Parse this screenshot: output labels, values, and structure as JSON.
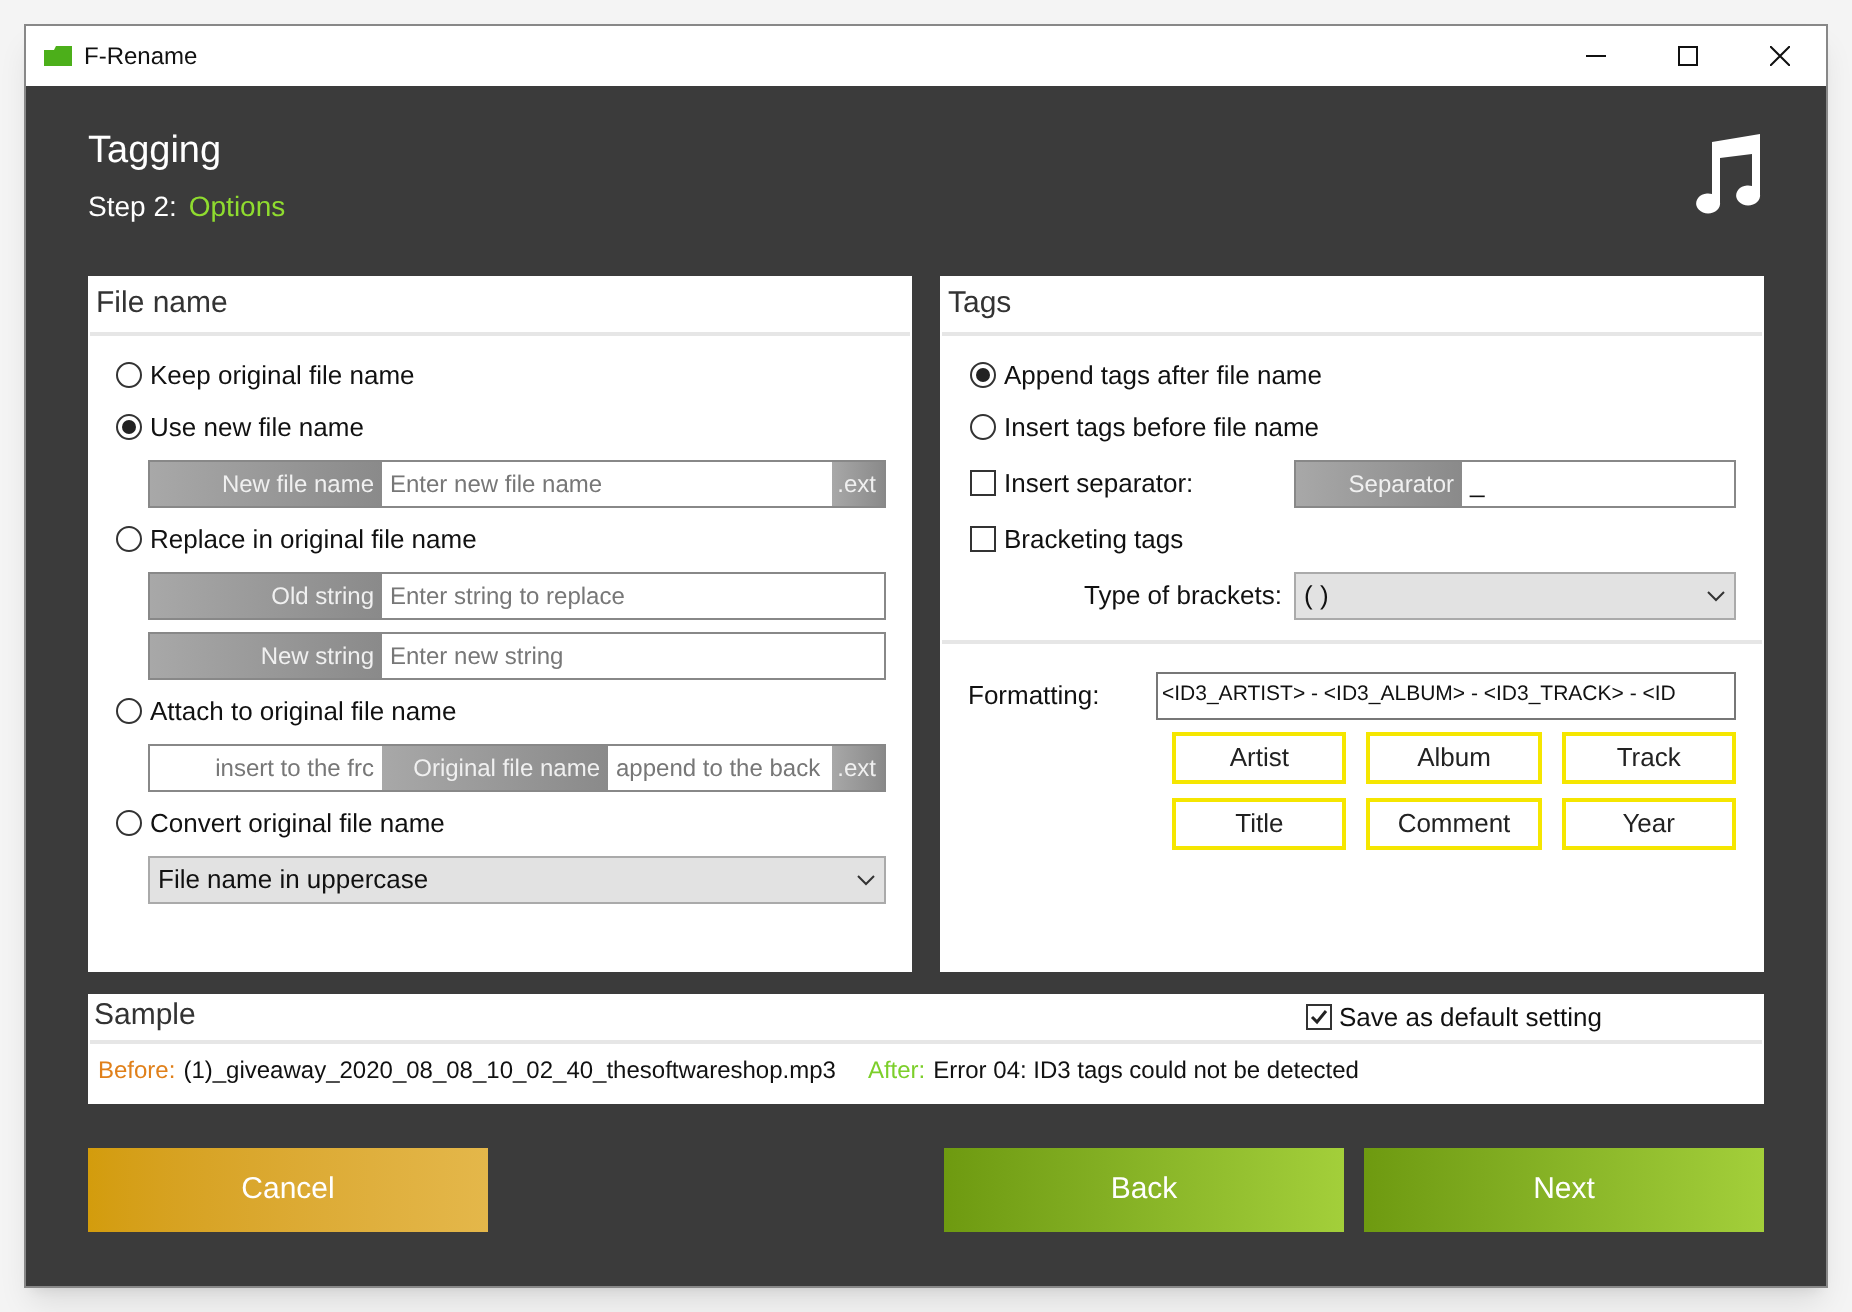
{
  "window": {
    "title": "F-Rename"
  },
  "header": {
    "title": "Tagging",
    "step_label": "Step 2:",
    "step_value": "Options"
  },
  "file_name": {
    "title": "File name",
    "options": [
      {
        "label": "Keep original file name",
        "selected": false
      },
      {
        "label": "Use new file name",
        "selected": true,
        "fields": [
          {
            "kind": "labeled",
            "label": "New file name",
            "placeholder": "Enter new file name",
            "suffix": ".ext"
          }
        ]
      },
      {
        "label": "Replace in original file name",
        "selected": false,
        "fields": [
          {
            "kind": "labeled",
            "label": "Old string",
            "placeholder": "Enter string to replace"
          },
          {
            "kind": "labeled",
            "label": "New string",
            "placeholder": "Enter new string"
          }
        ]
      },
      {
        "label": "Attach to original file name",
        "selected": false,
        "fields": [
          {
            "kind": "attach",
            "front_placeholder": "insert to the frc",
            "middle": "Original file name",
            "back_placeholder": "append to the back",
            "suffix": ".ext"
          }
        ]
      },
      {
        "label": "Convert original file name",
        "selected": false,
        "fields": [
          {
            "kind": "select",
            "value": "File name in uppercase"
          }
        ]
      }
    ]
  },
  "tags": {
    "title": "Tags",
    "options": [
      {
        "label": "Append tags after file name",
        "selected": true
      },
      {
        "label": "Insert tags before file name",
        "selected": false
      }
    ],
    "separator": {
      "label": "Insert separator:",
      "checked": false,
      "field_label": "Separator",
      "value": "_"
    },
    "bracketing": {
      "label": "Bracketing tags",
      "checked": false
    },
    "brackets": {
      "label": "Type of brackets:",
      "value": "( )"
    },
    "formatting": {
      "label": "Formatting:",
      "value": "<ID3_ARTIST> - <ID3_ALBUM> - <ID3_TRACK> - <ID"
    },
    "tag_buttons": [
      "Artist",
      "Album",
      "Track",
      "Title",
      "Comment",
      "Year"
    ]
  },
  "sample": {
    "title": "Sample",
    "save_default": {
      "label": "Save as default setting",
      "checked": true
    },
    "before_label": "Before:",
    "before_value": "(1)_giveaway_2020_08_08_10_02_40_thesoftwareshop.mp3",
    "after_label": "After:",
    "after_value": "Error 04: ID3 tags could not be detected"
  },
  "buttons": [
    {
      "kind": "cancel",
      "label": "Cancel"
    },
    {
      "kind": "back",
      "label": "Back"
    },
    {
      "kind": "next",
      "label": "Next"
    }
  ]
}
